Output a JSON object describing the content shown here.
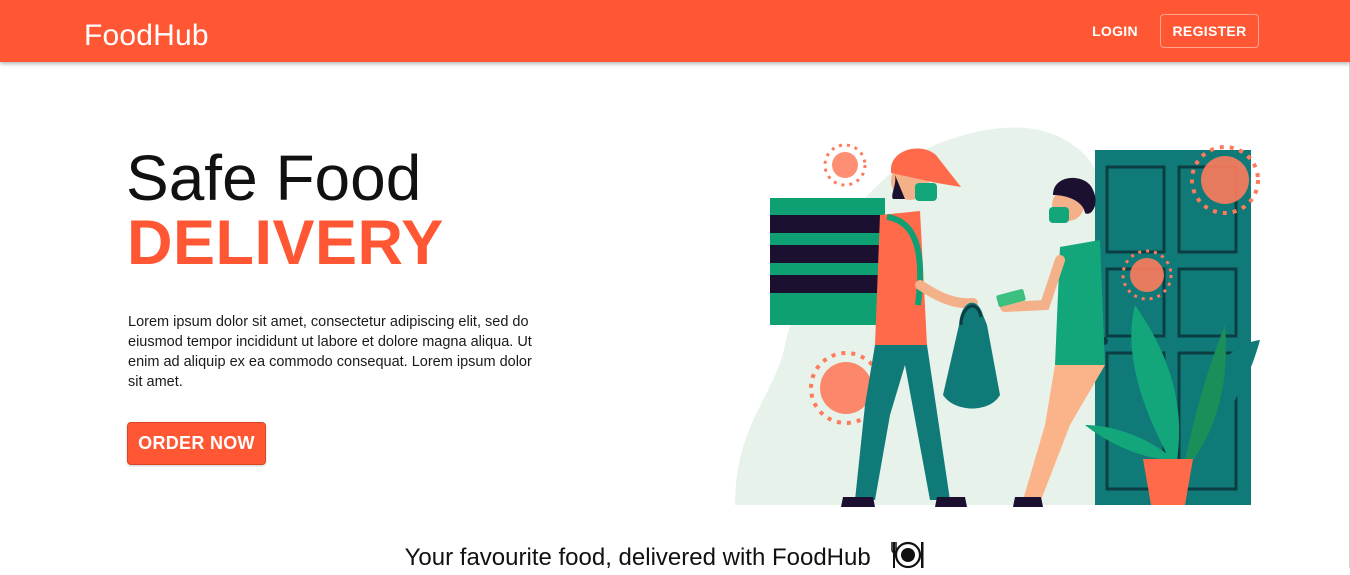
{
  "header": {
    "brand": "FoodHub",
    "login_label": "LOGIN",
    "register_label": "REGISTER"
  },
  "hero": {
    "title": "Safe Food",
    "accent": "DELIVERY",
    "description": "Lorem ipsum dolor sit amet, consectetur adipiscing elit, sed do eiusmod tempor incididunt ut labore et dolore magna aliqua. Ut enim ad aliquip ex ea commodo consequat. Lorem ipsum dolor sit amet.",
    "order_label": "ORDER NOW",
    "illustration_icon": "delivery-illustration"
  },
  "footer": {
    "tagline": "Your favourite food, delivered with FoodHub",
    "tagline_icon": "plate-icon"
  },
  "colors": {
    "primary": "#ff5733",
    "text": "#111111",
    "teal": "#0f7a78",
    "green": "#12a67a",
    "blob": "#e7f2ea"
  }
}
